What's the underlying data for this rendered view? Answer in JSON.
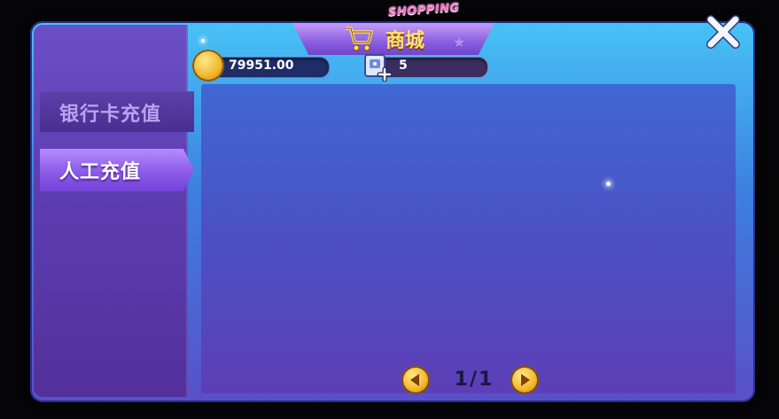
{
  "header": {
    "title": "商城",
    "subtitle": "SHOPPING"
  },
  "currency": {
    "coins": "79951.00",
    "tickets": "5"
  },
  "sidebar": {
    "items": [
      {
        "label": "银行卡充值",
        "active": false
      },
      {
        "label": "人工充值",
        "active": true
      }
    ]
  },
  "pagination": {
    "label": "1/1"
  },
  "icons": {
    "close": "close-icon",
    "cart": "cart-icon",
    "coin": "coin-icon",
    "ticket": "ticket-icon",
    "prev": "arrow-left-icon",
    "next": "arrow-right-icon"
  },
  "colors": {
    "title": "#ffe36b",
    "accent": "#8c5be8"
  }
}
